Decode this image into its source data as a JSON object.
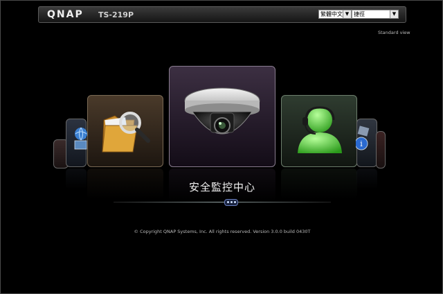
{
  "header": {
    "logo": "QNAP",
    "model": "TS-219P",
    "language_selected": "繁體中文",
    "option_selected": "捷徑"
  },
  "standard_view": "Standard view",
  "carousel": {
    "current_title": "安全監控中心",
    "items": [
      {
        "icon": "globe-icon"
      },
      {
        "icon": "folder-search-icon"
      },
      {
        "icon": "camera-icon",
        "label": "安全監控中心"
      },
      {
        "icon": "support-icon"
      },
      {
        "icon": "info-icon"
      }
    ]
  },
  "footer": {
    "copyright": "© Copyright QNAP Systems, Inc. All rights reserved. Version 3.0.0 build 0430T"
  },
  "colors": {
    "background": "#000000",
    "header": "#2a2a2a",
    "pager": "#6a7fc0"
  }
}
